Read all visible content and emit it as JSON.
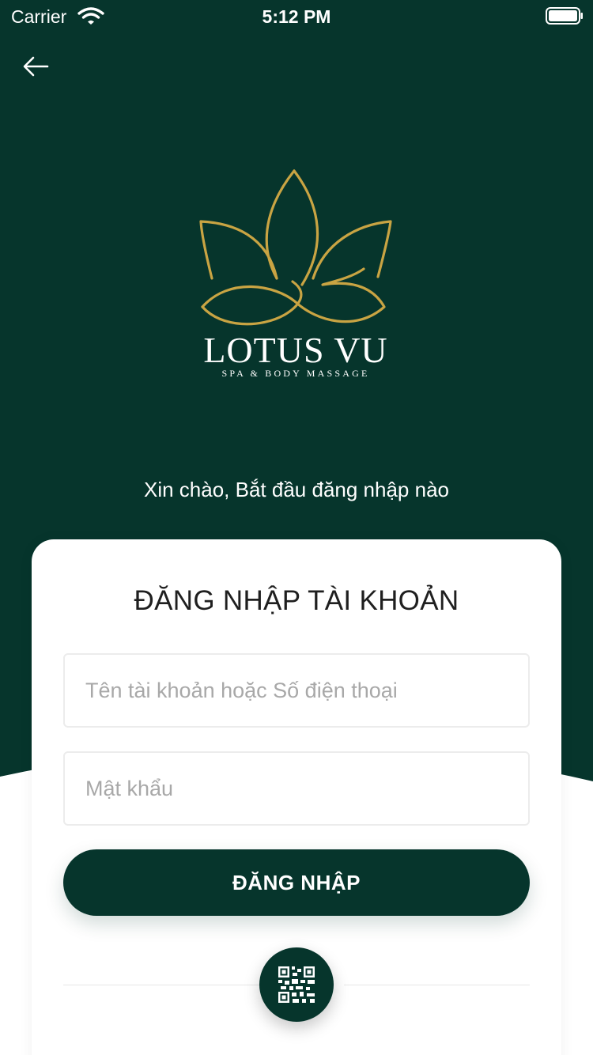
{
  "status_bar": {
    "carrier": "Carrier",
    "time": "5:12 PM"
  },
  "header": {
    "back_icon": "arrow-left-icon"
  },
  "logo": {
    "name": "LOTUS VU",
    "tagline": "SPA & BODY MASSAGE",
    "icon": "lotus-icon",
    "color": "#c9a443"
  },
  "greeting": "Xin chào, Bắt đầu đăng nhập nào",
  "login_card": {
    "title": "ĐĂNG NHẬP TÀI KHOẢN",
    "username_placeholder": "Tên tài khoản hoặc Số điện thoại",
    "username_value": "",
    "password_placeholder": "Mật khẩu",
    "password_value": "",
    "submit_label": "ĐĂNG NHẬP",
    "qr_icon": "qr-code-icon"
  },
  "colors": {
    "primary": "#06352c",
    "background": "#ffffff",
    "gold": "#c9a443"
  }
}
